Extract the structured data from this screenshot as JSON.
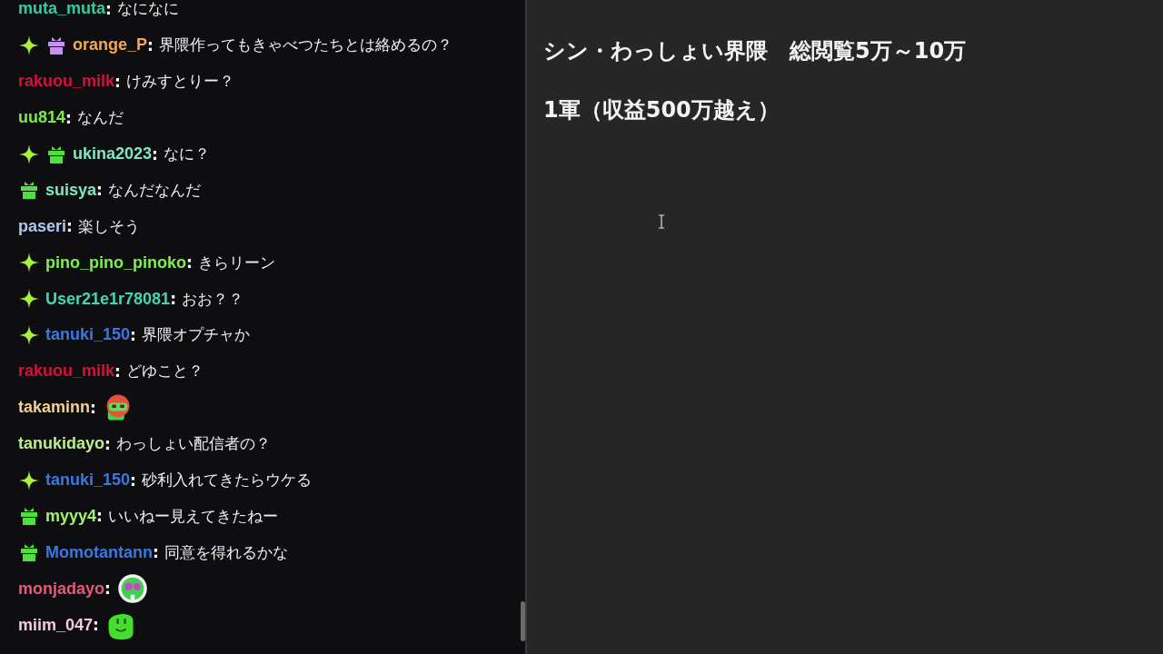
{
  "chat": {
    "messages": [
      {
        "user": "muta_muta",
        "separator": ":",
        "color": "#2fcf9c",
        "kind": "text",
        "text": "なになに"
      },
      {
        "user": "orange_P",
        "separator": ":",
        "color": "#f2aa52",
        "badges": [
          {
            "kind": "sparkle"
          },
          {
            "kind": "gift",
            "color": "#c890f0"
          }
        ],
        "kind": "text",
        "text": "界隈作ってもきゃべつたちとは絡めるの？"
      },
      {
        "user": "rakuou_milk",
        "separator": ":",
        "color": "#d3123c",
        "kind": "text",
        "text": "けみすとりー？"
      },
      {
        "user": "uu814",
        "separator": ":",
        "color": "#7ee84c",
        "kind": "text",
        "text": "なんだ"
      },
      {
        "user": "ukina2023",
        "separator": ":",
        "color": "#80e6c2",
        "badges": [
          {
            "kind": "sparkle"
          },
          {
            "kind": "gift",
            "color": "#4fe040"
          }
        ],
        "kind": "text",
        "text": "なに？"
      },
      {
        "user": "suisya",
        "separator": ":",
        "color": "#80e6c2",
        "badges": [
          {
            "kind": "gift",
            "color": "#4fe040"
          }
        ],
        "kind": "text",
        "text": "なんだなんだ"
      },
      {
        "user": "paseri",
        "separator": ":",
        "color": "#a9c8f2",
        "kind": "text",
        "text": "楽しそう"
      },
      {
        "user": "pino_pino_pinoko",
        "separator": ":",
        "color": "#7cf04c",
        "badges": [
          {
            "kind": "sparkle"
          }
        ],
        "kind": "text",
        "text": "きらリーン"
      },
      {
        "user": "User21e1r78081",
        "separator": ":",
        "color": "#42d8aa",
        "badges": [
          {
            "kind": "sparkle"
          }
        ],
        "kind": "text",
        "text": "おお？？"
      },
      {
        "user": "tanuki_150",
        "separator": ":",
        "color": "#3a78e2",
        "badges": [
          {
            "kind": "sparkle"
          }
        ],
        "kind": "text",
        "text": "界隈オプチャか"
      },
      {
        "user": "rakuou_milk",
        "separator": ":",
        "color": "#d3123c",
        "kind": "text",
        "text": "どゆこと？"
      },
      {
        "user": "takaminn",
        "separator": ":",
        "color": "#f2d092",
        "kind": "emote-a"
      },
      {
        "user": "tanukidayo",
        "separator": ":",
        "color": "#baf08c",
        "kind": "text",
        "text": "わっしょい配信者の？"
      },
      {
        "user": "tanuki_150",
        "separator": ":",
        "color": "#3a78e2",
        "badges": [
          {
            "kind": "sparkle"
          }
        ],
        "kind": "text",
        "text": "砂利入れてきたらウケる"
      },
      {
        "user": "myyy4",
        "separator": ":",
        "color": "#a2f072",
        "badges": [
          {
            "kind": "gift",
            "color": "#4fe040"
          }
        ],
        "kind": "text",
        "text": "いいねー見えてきたねー"
      },
      {
        "user": "Momotantann",
        "separator": ":",
        "color": "#3a78e2",
        "badges": [
          {
            "kind": "gift",
            "color": "#4fe040"
          }
        ],
        "kind": "text",
        "text": "同意を得れるかな"
      },
      {
        "user": "monjadayo",
        "separator": ":",
        "color": "#e25a7a",
        "kind": "emote-b"
      },
      {
        "user": "miim_047",
        "separator": ":",
        "color": "#f2cada",
        "kind": "emote-c"
      }
    ]
  },
  "note": {
    "lines": [
      "シン・わっしょい界隈　総閲覧5万～10万",
      "1軍（収益500万越え）"
    ]
  }
}
